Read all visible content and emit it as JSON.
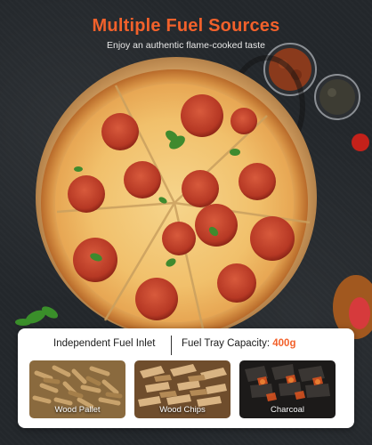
{
  "header": {
    "title": "Multiple Fuel Sources",
    "subtitle": "Enjoy an authentic flame-cooked taste"
  },
  "features": {
    "inlet": "Independent Fuel Inlet",
    "capacity_label": "Fuel Tray Capacity: ",
    "capacity_value": "400g"
  },
  "fuels": [
    {
      "label": "Wood Pallet"
    },
    {
      "label": "Wood Chips"
    },
    {
      "label": "Charcoal"
    }
  ],
  "colors": {
    "accent": "#f2612b",
    "background": "#23272b"
  }
}
